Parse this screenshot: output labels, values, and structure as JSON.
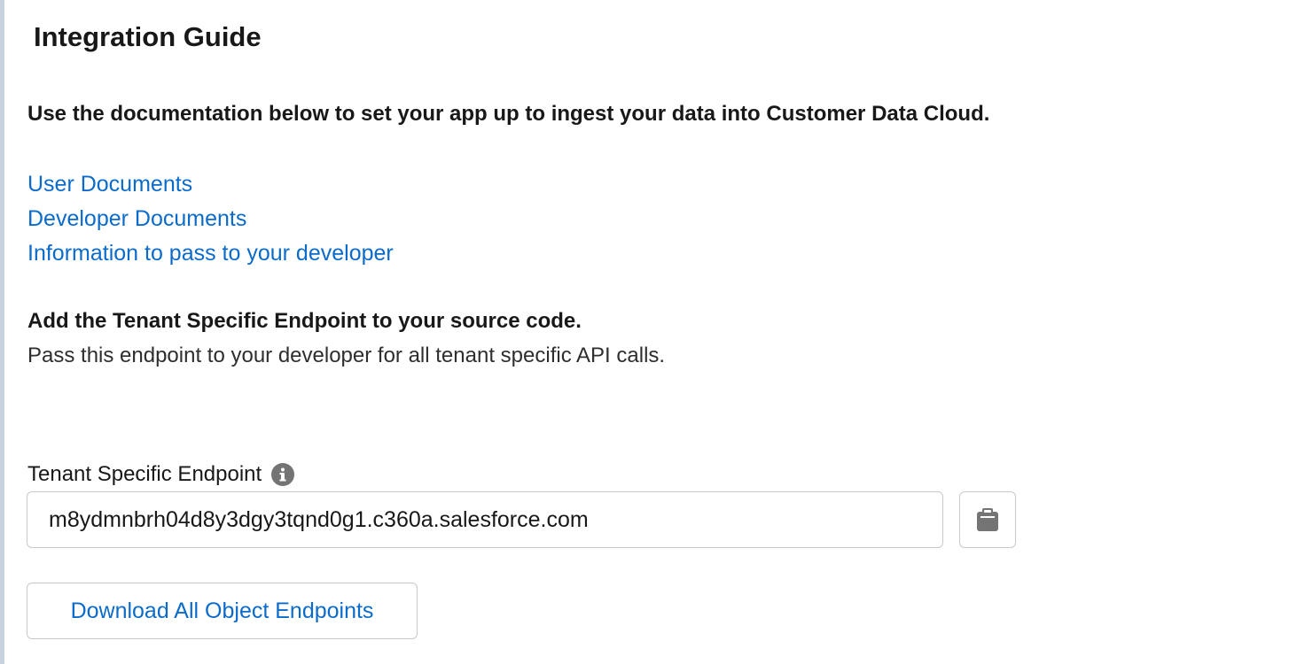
{
  "page": {
    "title": "Integration Guide",
    "intro": "Use the documentation below to set your app up to ingest your data into Customer Data Cloud."
  },
  "links": {
    "user_docs": "User Documents",
    "developer_docs": "Developer Documents",
    "info_for_developer": "Information to pass to your developer"
  },
  "endpoint_section": {
    "heading": "Add the Tenant Specific Endpoint to your source code.",
    "description": "Pass this endpoint to your developer for all tenant specific API calls."
  },
  "endpoint_field": {
    "label": "Tenant Specific Endpoint",
    "value": "m8ydmnbrh04d8y3dgy3tqnd0g1.c360a.salesforce.com",
    "info_icon": "info-icon",
    "copy_icon": "clipboard-icon"
  },
  "actions": {
    "download_all": "Download All Object Endpoints"
  },
  "colors": {
    "link": "#0b6bcb",
    "border": "#c9c9c9",
    "icon": "#747474",
    "text": "#181818"
  }
}
